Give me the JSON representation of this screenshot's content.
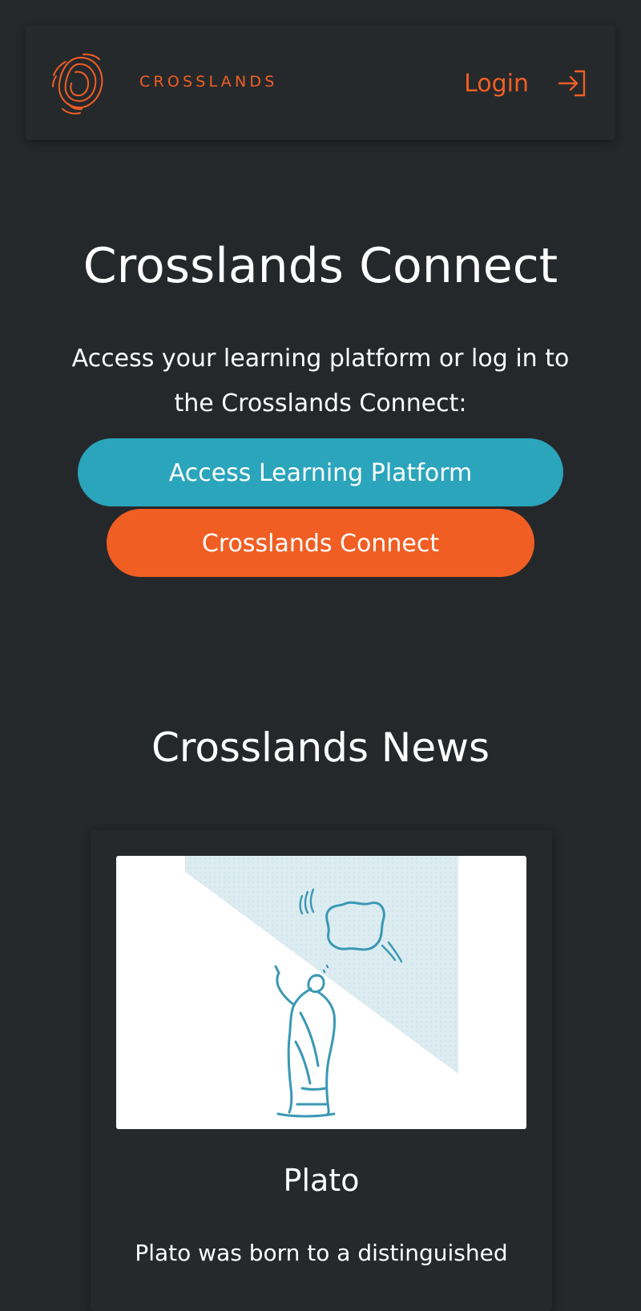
{
  "header": {
    "brand": "CROSSLANDS",
    "logo_icon": "fingerprint-globe-logo",
    "login_label": "Login",
    "login_icon": "login-arrow-icon"
  },
  "hero": {
    "title": "Crosslands Connect",
    "subtitle": "Access your learning platform or log in to the Crosslands Connect:",
    "primary_button": "Access Learning Platform",
    "secondary_button": "Crosslands Connect"
  },
  "news": {
    "section_title": "Crosslands News",
    "articles": [
      {
        "title": "Plato",
        "excerpt": "Plato was born to a distinguished",
        "image_icon": "plato-illustration"
      }
    ]
  },
  "colors": {
    "background": "#24282b",
    "accent_orange": "#f15e23",
    "accent_teal": "#2aa5bc",
    "text": "#ffffff"
  }
}
